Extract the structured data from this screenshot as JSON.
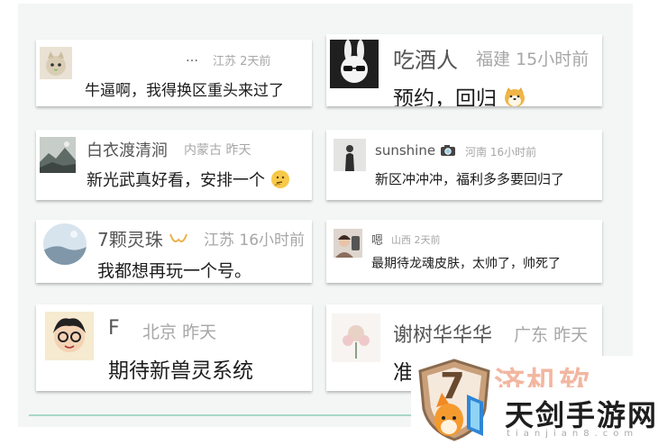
{
  "comments": [
    {
      "name": "…",
      "location": "江苏",
      "time": "2天前",
      "text": "牛逼啊，我得换区重头来过了",
      "avatar_icon": "cat-avatar-icon"
    },
    {
      "name": "吃酒人",
      "location": "福建",
      "time": "15小时前",
      "text": "预约，回归",
      "emoji": "shiba-emoji-icon",
      "avatar_icon": "rabbit-sunglasses-avatar-icon"
    },
    {
      "name": "白衣渡清涧",
      "location": "内蒙古",
      "time": "昨天",
      "text": "新光武真好看，安排一个",
      "emoji": "thinking-emoji-icon",
      "avatar_icon": "landscape-avatar-icon"
    },
    {
      "name": "sunshine",
      "location": "河南",
      "time": "16小时前",
      "text": "新区冲冲冲，福利多多要回归了",
      "name_icon": "camera-icon",
      "avatar_icon": "person-avatar-icon"
    },
    {
      "name": "7颗灵珠",
      "location": "江苏",
      "time": "16小时前",
      "text": "我都想再玩一个号。",
      "name_icon": "ribbon-icon",
      "avatar_icon": "sky-avatar-icon"
    },
    {
      "name": "嗯",
      "location": "山西",
      "time": "2天前",
      "text": "最期待龙魂皮肤，太帅了，帅死了",
      "avatar_icon": "selfie-avatar-icon"
    },
    {
      "name": "F",
      "location": "北京",
      "time": "昨天",
      "text": "期待新兽灵系统",
      "avatar_icon": "cartoon-boy-avatar-icon"
    },
    {
      "name": "谢树华华华",
      "location": "广东",
      "time": "昨天",
      "text": "准",
      "avatar_icon": "flower-avatar-icon"
    }
  ],
  "watermark": {
    "top_text": "济机软",
    "title": "天剑手游网",
    "url": "tianjian8.com",
    "shield_digit": "7"
  }
}
